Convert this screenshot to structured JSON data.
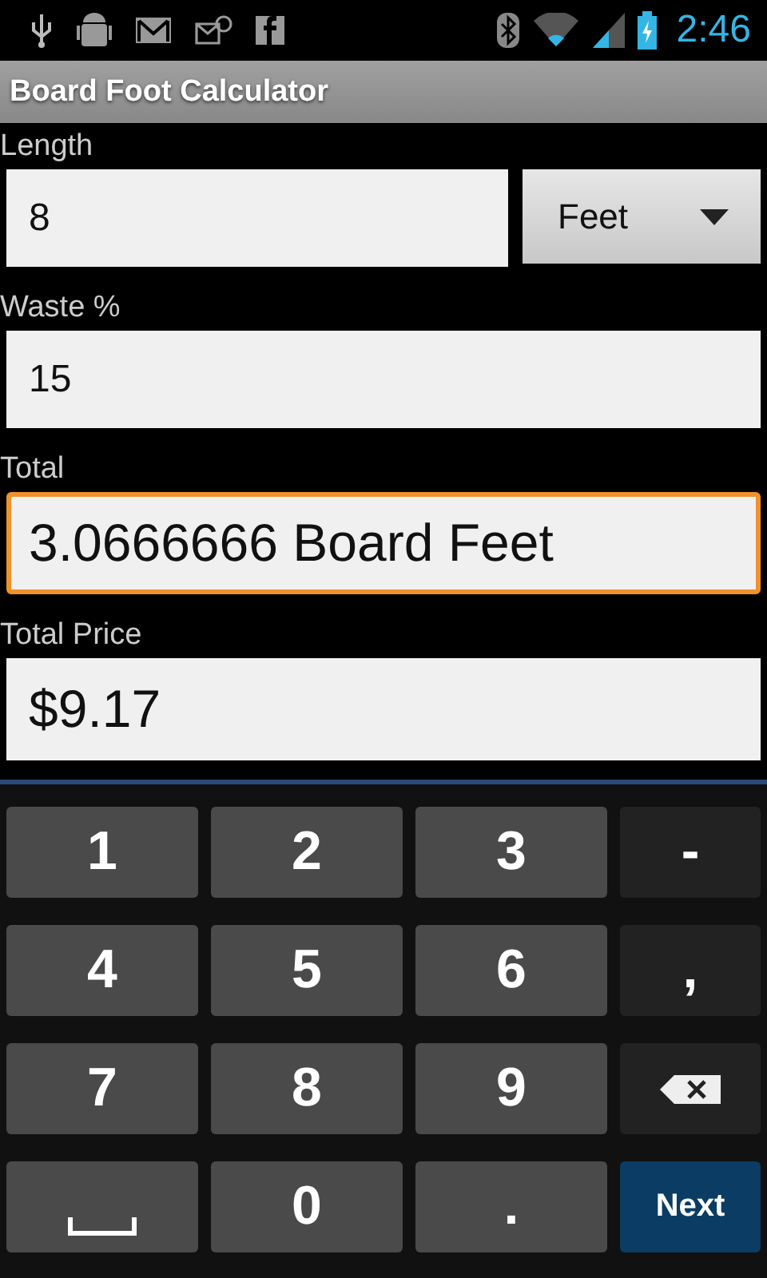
{
  "status_bar": {
    "time": "2:46"
  },
  "window": {
    "title": "Board Foot Calculator"
  },
  "fields": [
    {
      "label": "Length",
      "value": "8",
      "kind": "input",
      "focused": false,
      "unit": {
        "value": "Feet"
      }
    },
    {
      "label": "Waste %",
      "value": "15",
      "kind": "input",
      "focused": false
    },
    {
      "label": "Total",
      "value": "3.0666666 Board Feet",
      "kind": "result",
      "focused": true
    },
    {
      "label": "Total Price",
      "value": "$9.17",
      "kind": "result",
      "focused": false
    }
  ],
  "keyboard": {
    "keys": [
      {
        "kind": "char",
        "label": "1"
      },
      {
        "kind": "char",
        "label": "2"
      },
      {
        "kind": "char",
        "label": "3"
      },
      {
        "kind": "symbol",
        "label": "-"
      },
      {
        "kind": "char",
        "label": "4"
      },
      {
        "kind": "char",
        "label": "5"
      },
      {
        "kind": "char",
        "label": "6"
      },
      {
        "kind": "symbol",
        "label": ","
      },
      {
        "kind": "char",
        "label": "7"
      },
      {
        "kind": "char",
        "label": "8"
      },
      {
        "kind": "char",
        "label": "9"
      },
      {
        "kind": "backspace"
      },
      {
        "kind": "space"
      },
      {
        "kind": "char",
        "label": "0"
      },
      {
        "kind": "char",
        "label": "."
      },
      {
        "kind": "action",
        "label": "Next"
      }
    ]
  }
}
